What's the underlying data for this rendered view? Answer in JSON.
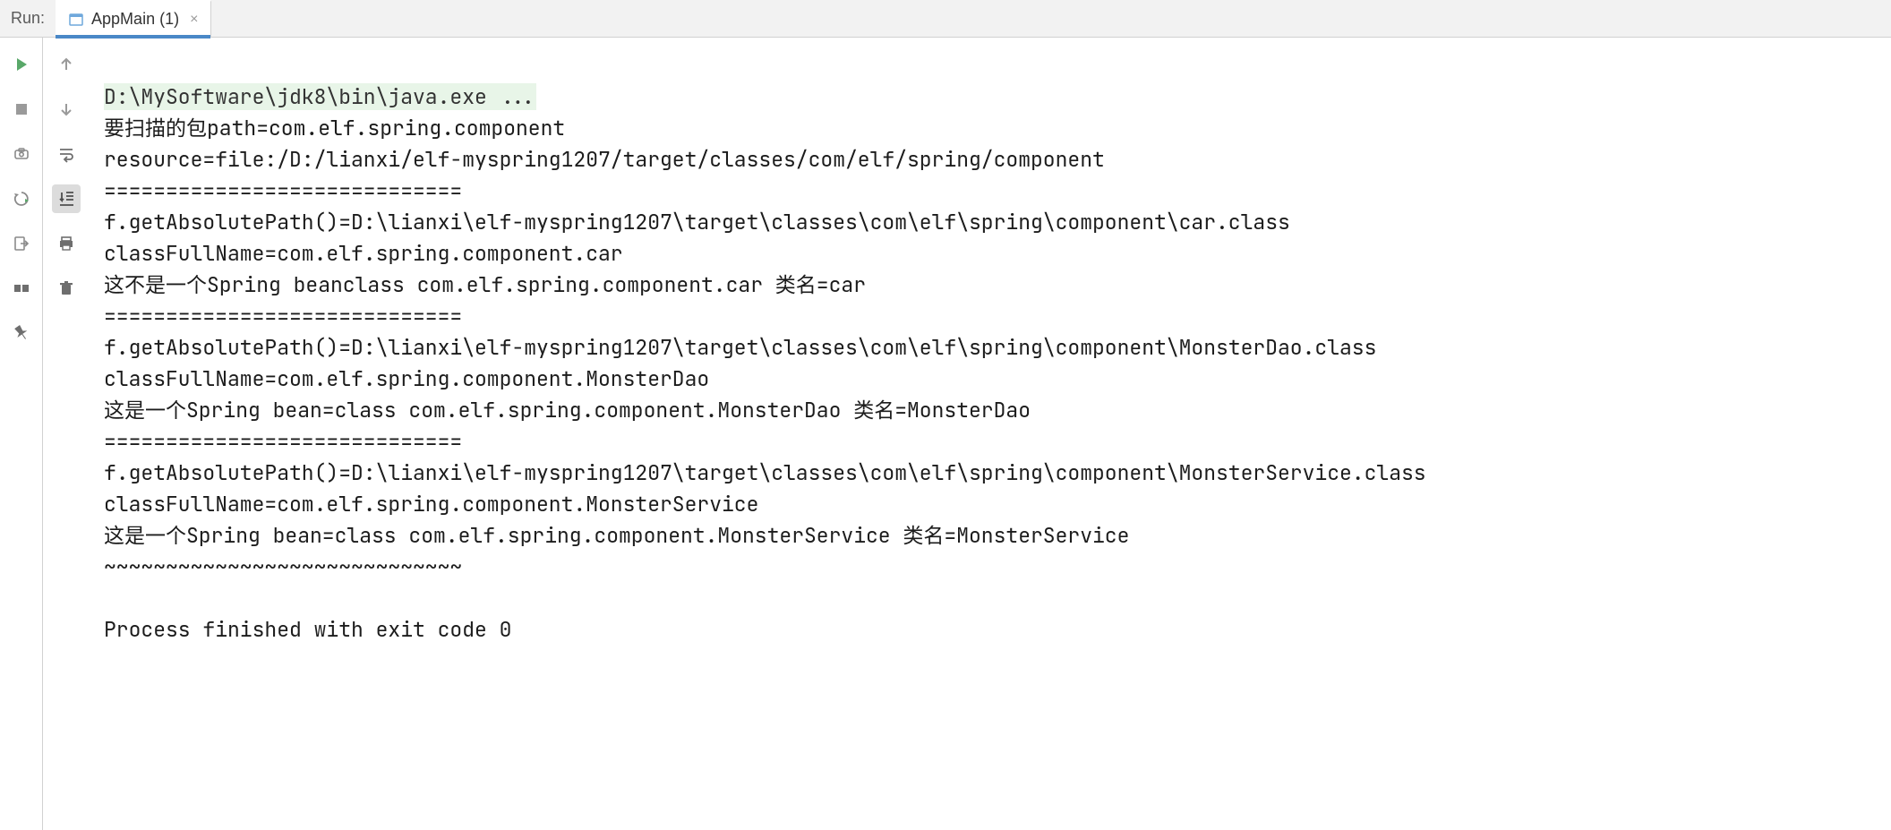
{
  "header": {
    "run_label": "Run:",
    "tab": {
      "label": "AppMain (1)"
    }
  },
  "console": {
    "command": "D:\\MySoftware\\jdk8\\bin\\java.exe ...",
    "lines": [
      "要扫描的包path=com.elf.spring.component",
      "resource=file:/D:/lianxi/elf-myspring1207/target/classes/com/elf/spring/component",
      "=============================",
      "f.getAbsolutePath()=D:\\lianxi\\elf-myspring1207\\target\\classes\\com\\elf\\spring\\component\\car.class",
      "classFullName=com.elf.spring.component.car",
      "这不是一个Spring beanclass com.elf.spring.component.car 类名=car",
      "=============================",
      "f.getAbsolutePath()=D:\\lianxi\\elf-myspring1207\\target\\classes\\com\\elf\\spring\\component\\MonsterDao.class",
      "classFullName=com.elf.spring.component.MonsterDao",
      "这是一个Spring bean=class com.elf.spring.component.MonsterDao 类名=MonsterDao",
      "=============================",
      "f.getAbsolutePath()=D:\\lianxi\\elf-myspring1207\\target\\classes\\com\\elf\\spring\\component\\MonsterService.class",
      "classFullName=com.elf.spring.component.MonsterService",
      "这是一个Spring bean=class com.elf.spring.component.MonsterService 类名=MonsterService",
      "~~~~~~~~~~~~~~~~~~~~~~~~~~~~~"
    ],
    "exit_message": "Process finished with exit code 0"
  },
  "icons": {
    "run": "run-icon",
    "stop": "stop-icon",
    "camera": "camera-icon",
    "restart": "restart-icon",
    "exit": "exit-icon",
    "layout": "layout-icon",
    "pin": "pin-icon",
    "up": "arrow-up-icon",
    "down": "arrow-down-icon",
    "wrap": "soft-wrap-icon",
    "scroll": "scroll-to-end-icon",
    "print": "print-icon",
    "trash": "trash-icon"
  }
}
